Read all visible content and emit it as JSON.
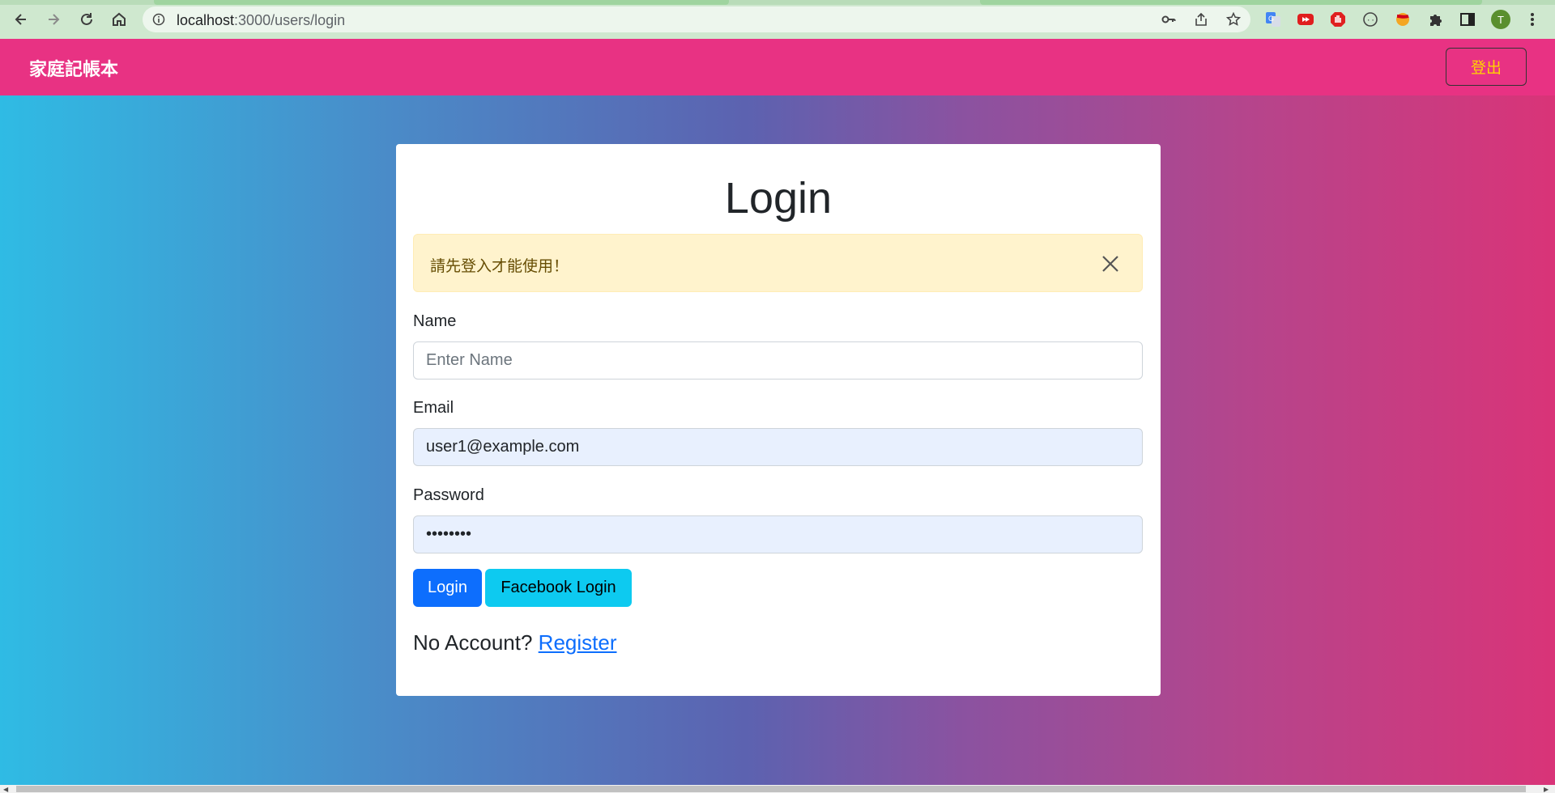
{
  "browser": {
    "url_host": "localhost",
    "url_rest": ":3000/users/login",
    "profile_initial": "T"
  },
  "navbar": {
    "brand": "家庭記帳本",
    "logout_label": "登出"
  },
  "card": {
    "title": "Login",
    "alert_text": "請先登入才能使用！",
    "name_label": "Name",
    "name_placeholder": "Enter Name",
    "name_value": "",
    "email_label": "Email",
    "email_value": "user1@example.com",
    "password_label": "Password",
    "password_value": "••••••••",
    "login_button": "Login",
    "facebook_button": "Facebook Login",
    "register_prompt": "No Account?",
    "register_link": "Register"
  },
  "colors": {
    "navbar": "#e83283",
    "logout_text": "#ffd400",
    "primary": "#0d6efd",
    "info": "#0dcaf0",
    "alert_bg": "#fff3cd"
  }
}
